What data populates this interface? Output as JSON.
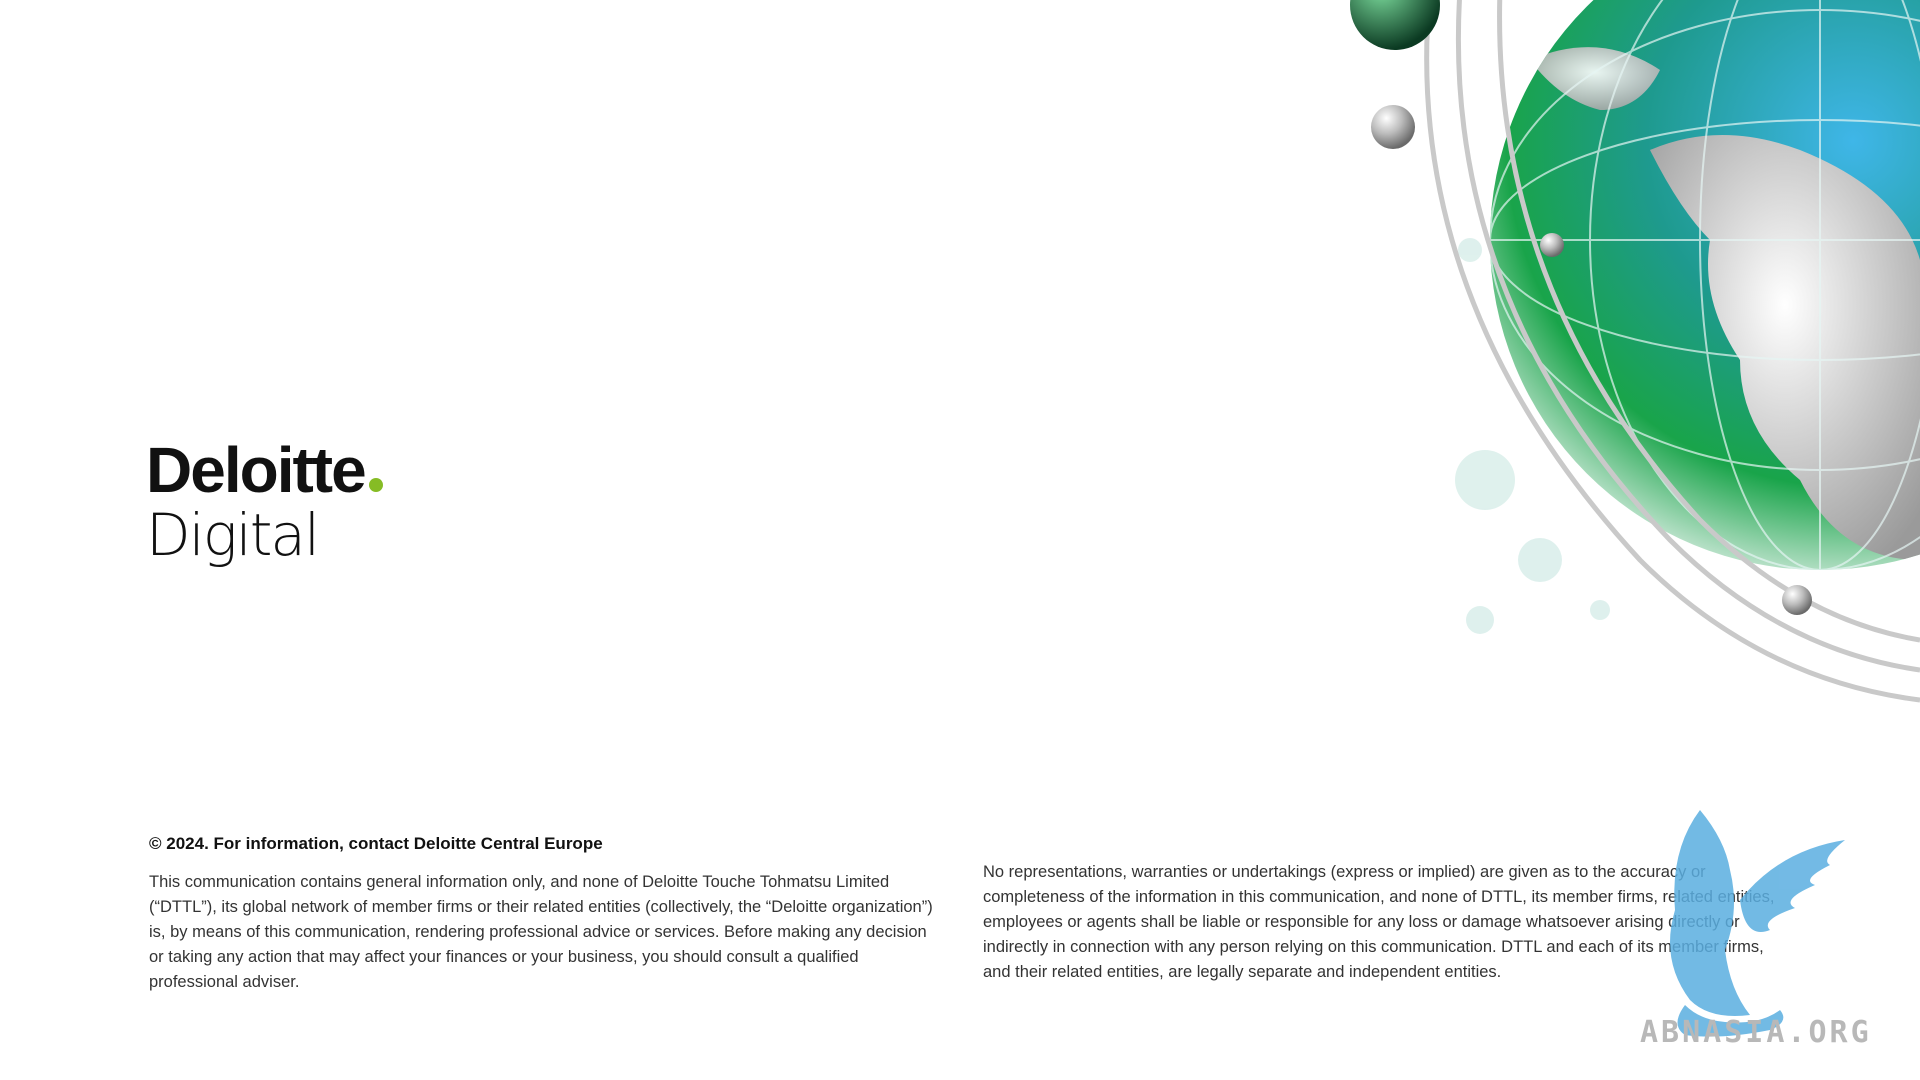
{
  "logo": {
    "brand": "Deloitte",
    "sub": "Digital",
    "dot_color": "#86bc25"
  },
  "footer": {
    "contact_heading": "© 2024. For information, contact Deloitte Central Europe",
    "disclaimer_left": "This communication contains general information only, and none of Deloitte Touche Tohmatsu Limited (“DTTL”), its global network of member firms or their related entities (collectively, the “Deloitte organization”) is, by means of this communication, rendering professional advice or services. Before making any decision or taking any action that may affect your finances or your business, you should consult a qualified professional adviser.",
    "disclaimer_right": "No representations, warranties or undertakings (express or implied) are given as to the accuracy or completeness of the information in this communication, and none of DTTL, its member firms, related entities, employees or agents shall be liable or responsible for any loss or damage whatsoever arising directly or indirectly in connection with any person relying on this communication. DTTL and each of its member firms, and their related entities, are legally separate and independent entities."
  },
  "watermark": {
    "text": "ABNASIA.ORG",
    "color": "#5aaee0"
  },
  "art": {
    "icon": "globe-icon"
  }
}
